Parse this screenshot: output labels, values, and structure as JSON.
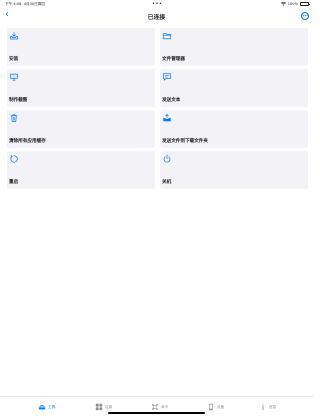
{
  "status_bar": {
    "time": "下午 4:08",
    "date": "4月30日周四",
    "dots": "•••",
    "battery": "100%"
  },
  "nav": {
    "back_icon": "‹",
    "title": "已连接",
    "more_icon": "•••"
  },
  "actions": [
    {
      "label": "安装",
      "icon": "tray-install-icon"
    },
    {
      "label": "文件管理器",
      "icon": "folder-icon"
    },
    {
      "label": "制作截图",
      "icon": "monitor-screenshot-icon"
    },
    {
      "label": "发送文本",
      "icon": "message-text-icon"
    },
    {
      "label": "清除所有应用缓存",
      "icon": "trash-icon"
    },
    {
      "label": "发送文件到下载文件夹",
      "icon": "tray-upload-icon"
    },
    {
      "label": "重启",
      "icon": "restart-icon"
    },
    {
      "label": "关机",
      "icon": "power-icon"
    }
  ],
  "tabs": [
    {
      "label": "工具",
      "icon": "toolbox-icon",
      "active": true
    },
    {
      "label": "应用",
      "icon": "apps-grid-icon",
      "active": false
    },
    {
      "label": "命令",
      "icon": "command-icon",
      "active": false
    },
    {
      "label": "设备",
      "icon": "device-icon",
      "active": false
    },
    {
      "label": "信息",
      "icon": "info-icon",
      "active": false
    }
  ],
  "colors": {
    "accent": "#007aff",
    "card_bg": "#f2f2f7",
    "text": "#1c1c1e",
    "inactive": "#8e8e93"
  }
}
